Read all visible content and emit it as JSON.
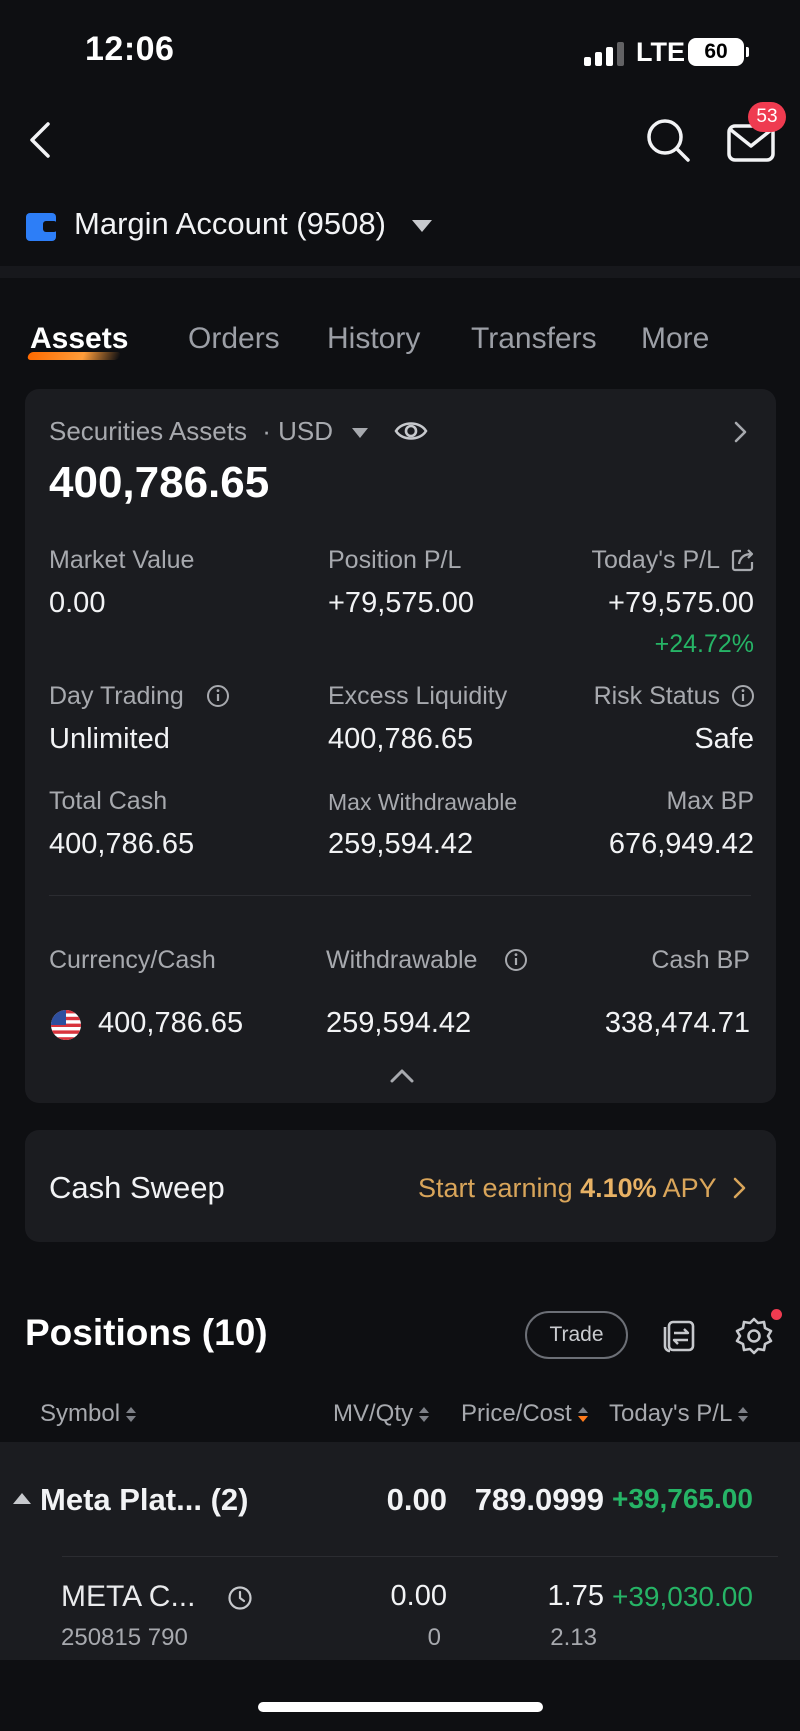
{
  "status_bar": {
    "time": "12:06",
    "network": "LTE",
    "battery": "60"
  },
  "header": {
    "mail_badge": "53"
  },
  "account": {
    "name": "Margin Account (9508)"
  },
  "tabs": [
    {
      "label": "Assets",
      "active": true
    },
    {
      "label": "Orders",
      "active": false
    },
    {
      "label": "History",
      "active": false
    },
    {
      "label": "Transfers",
      "active": false
    },
    {
      "label": "More",
      "active": false
    }
  ],
  "assets": {
    "label": "Securities Assets",
    "currency": "· USD",
    "total": "400,786.65",
    "metrics": {
      "market_value": {
        "label": "Market Value",
        "value": "0.00"
      },
      "position_pl": {
        "label": "Position P/L",
        "value": "+79,575.00"
      },
      "todays_pl": {
        "label": "Today's P/L",
        "value": "+79,575.00",
        "percent": "+24.72%"
      },
      "day_trading": {
        "label": "Day Trading",
        "value": "Unlimited"
      },
      "excess_liquidity": {
        "label": "Excess Liquidity",
        "value": "400,786.65"
      },
      "risk_status": {
        "label": "Risk Status",
        "value": "Safe"
      },
      "total_cash": {
        "label": "Total Cash",
        "value": "400,786.65"
      },
      "max_withdrawable": {
        "label": "Max Withdrawable",
        "value": "259,594.42"
      },
      "max_bp": {
        "label": "Max BP",
        "value": "676,949.42"
      }
    },
    "cash_table": {
      "headers": {
        "currency": "Currency/Cash",
        "withdrawable": "Withdrawable",
        "cash_bp": "Cash BP"
      },
      "row": {
        "cash": "400,786.65",
        "withdrawable": "259,594.42",
        "cash_bp": "338,474.71"
      }
    }
  },
  "cash_sweep": {
    "title": "Cash Sweep",
    "cta_prefix": "Start earning ",
    "rate": "4.10%",
    "cta_suffix": " APY"
  },
  "positions": {
    "title": "Positions (10)",
    "trade_label": "Trade",
    "columns": {
      "symbol": "Symbol",
      "mv_qty": "MV/Qty",
      "price_cost": "Price/Cost",
      "todays_pl": "Today's P/L"
    },
    "group": {
      "name": "Meta Plat...",
      "count": "(2)",
      "mv": "0.00",
      "price": "789.0999",
      "pl": "+39,765.00"
    },
    "option": {
      "name": "META C...",
      "sub": "250815 790",
      "mv": "0.00",
      "qty": "0",
      "price": "1.75",
      "cost": "2.13",
      "pl": "+39,030.00"
    }
  },
  "colors": {
    "positive": "#26b466",
    "accent": "#ff7a1a",
    "badge": "#ef3b50",
    "sweep": "#d9a55a",
    "account_icon": "#2d7ef7"
  }
}
